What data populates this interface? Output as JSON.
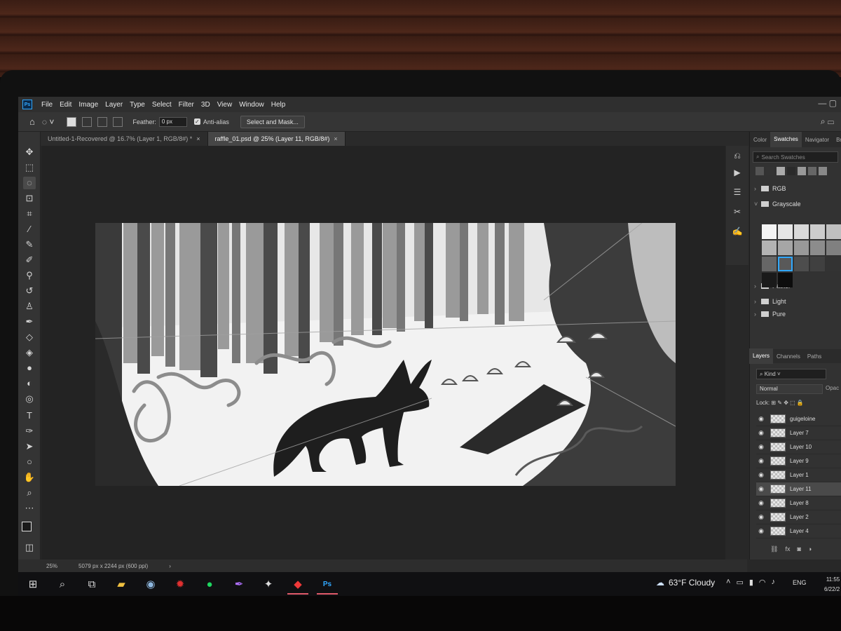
{
  "menubar": {
    "app_icon": "Ps",
    "items": [
      "File",
      "Edit",
      "Image",
      "Layer",
      "Type",
      "Select",
      "Filter",
      "3D",
      "View",
      "Window",
      "Help"
    ]
  },
  "options": {
    "feather_label": "Feather:",
    "feather_value": "0 px",
    "antialias_label": "Anti-alias",
    "antialias_checked": true,
    "select_mask_label": "Select and Mask..."
  },
  "tabs": [
    {
      "label": "Untitled-1-Recovered @ 16.7% (Layer 1, RGB/8#) *",
      "active": false
    },
    {
      "label": "raffle_01.psd @ 25% (Layer 11, RGB/8#)",
      "active": true
    }
  ],
  "status": {
    "zoom": "25%",
    "doc_info": "5079 px x 2244 px (600 ppi)"
  },
  "panels": {
    "tabs": [
      "Color",
      "Swatches",
      "Navigator",
      "Br"
    ],
    "active_tab": "Swatches",
    "search_placeholder": "Search Swatches",
    "folders": [
      "RGB",
      "Grayscale",
      "Pastel",
      "Light",
      "Pure"
    ]
  },
  "layers_panel": {
    "tabs": [
      "Layers",
      "Channels",
      "Paths"
    ],
    "kind_label": "Kind",
    "blend_mode": "Normal",
    "opacity_label": "Opac",
    "lock_label": "Lock:",
    "layers": [
      {
        "name": "guigeloine",
        "selected": false
      },
      {
        "name": "Layer 7",
        "selected": false
      },
      {
        "name": "Layer 10",
        "selected": false
      },
      {
        "name": "Layer 9",
        "selected": false
      },
      {
        "name": "Layer 1",
        "selected": false
      },
      {
        "name": "Layer 11",
        "selected": true
      },
      {
        "name": "Layer 8",
        "selected": false
      },
      {
        "name": "Layer 2",
        "selected": false
      },
      {
        "name": "Layer 4",
        "selected": false
      }
    ],
    "footer_icons": [
      "link-icon",
      "fx-icon",
      "mask-icon",
      "adjustment-icon"
    ]
  },
  "taskbar": {
    "weather": "63°F Cloudy",
    "lang": "ENG",
    "time": "11:55",
    "date": "6/22/2"
  },
  "colors": {
    "ps_blue": "#31a8ff",
    "running_indicator": "#e05a6a"
  }
}
